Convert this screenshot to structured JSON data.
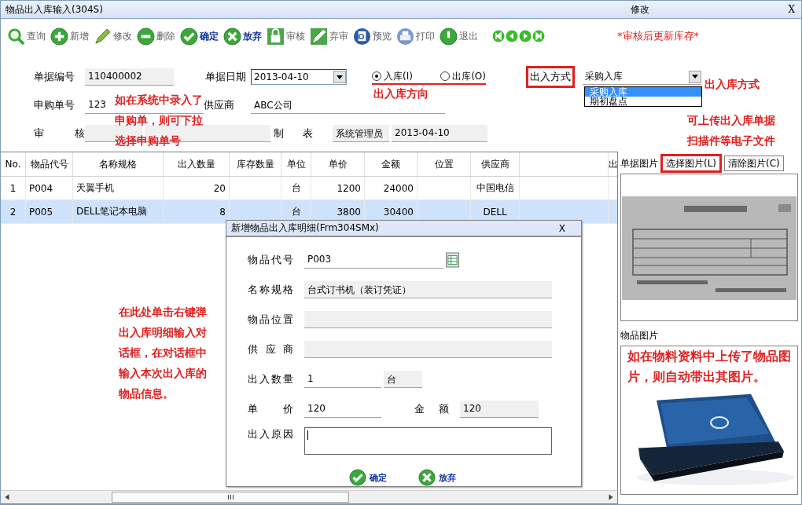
{
  "window": {
    "title": "物品出入库输入(304S)",
    "mode": "修改",
    "close": "X"
  },
  "toolbar": [
    {
      "label": "查询",
      "kind": "search",
      "disabled": true
    },
    {
      "label": "新增",
      "kind": "add",
      "disabled": true
    },
    {
      "label": "修改",
      "kind": "edit",
      "disabled": true
    },
    {
      "label": "删除",
      "kind": "delete",
      "disabled": true
    },
    {
      "label": "确定",
      "kind": "confirm",
      "disabled": false
    },
    {
      "label": "放弃",
      "kind": "cancel",
      "disabled": false
    },
    {
      "label": "审核",
      "kind": "audit",
      "disabled": true
    },
    {
      "label": "弃审",
      "kind": "unaudit",
      "disabled": true
    },
    {
      "label": "预览",
      "kind": "preview",
      "disabled": true
    },
    {
      "label": "打印",
      "kind": "print",
      "disabled": true
    },
    {
      "label": "退出",
      "kind": "exit",
      "disabled": true
    }
  ],
  "toolbar_note": "*审核后更新库存*",
  "form": {
    "doc_no": {
      "label": "单据编号",
      "value": "110400002"
    },
    "doc_date": {
      "label": "单据日期",
      "value": "2013-04-10"
    },
    "direction": [
      {
        "label": "入库(I)",
        "selected": true
      },
      {
        "label": "出库(O)",
        "selected": false
      }
    ],
    "direction_note": "出入库方向",
    "method": {
      "label": "出入方式",
      "highlighted": true,
      "value": "采购入库",
      "options": [
        {
          "label": "采购入库",
          "selected": true
        },
        {
          "label": "期初盘点",
          "selected": false
        }
      ],
      "note": "出入库方式"
    },
    "request_no": {
      "label": "申购单号",
      "value": "123",
      "note": "如在系统中录入了申购单，则可下拉选择申购单号"
    },
    "supplier": {
      "label": "供应商",
      "value": "ABC公司"
    },
    "reviewer": {
      "label": "审 核"
    },
    "maker": {
      "label": "制 表",
      "value": "系统管理员",
      "date": "2013-04-10"
    },
    "upload_note": "可上传出入库单据扫描件等电子文件"
  },
  "table": {
    "columns": [
      "No.",
      "物品代号",
      "名称规格",
      "出入数量",
      "库存数量",
      "单位",
      "单价",
      "金额",
      "位置",
      "供应商",
      "出"
    ],
    "rows": [
      {
        "no": "1",
        "code": "P004",
        "name": "天翼手机",
        "qty": "20",
        "unit": "台",
        "price": "1200",
        "amount": "24000",
        "supplier": "中国电信",
        "selected": false
      },
      {
        "no": "2",
        "code": "P005",
        "name": "DELL笔记本电脑",
        "qty": "8",
        "unit": "台",
        "price": "3800",
        "amount": "30400",
        "supplier": "DELL",
        "selected": true
      }
    ],
    "note": "在此处单击右键弹出入库明细输入对话框，在对话框中输入本次出入库的物品信息。"
  },
  "dialog": {
    "title": "新增物品出入库明细(Frm304SMx)",
    "close": "X",
    "fields": [
      {
        "label": "物品代号",
        "value": "P003",
        "kind": "lookup"
      },
      {
        "label": "名称规格",
        "value": "台式订书机（装订凭证）",
        "kind": "readonly"
      },
      {
        "label": "物品位置",
        "kind": "readonly"
      },
      {
        "label": "供应商",
        "kind": "readonly"
      },
      {
        "label": "出入数量",
        "value": "1",
        "unit": "台",
        "kind": "quantity"
      },
      {
        "label": "单 价",
        "value": "120",
        "total_label": "金 额",
        "total": "120",
        "kind": "price"
      },
      {
        "label": "出入原因",
        "kind": "memo"
      }
    ],
    "buttons": [
      {
        "label": "确定",
        "kind": "confirm"
      },
      {
        "label": "放弃",
        "kind": "cancel"
      }
    ]
  },
  "attachments": {
    "label": "单据图片",
    "buttons": [
      {
        "label": "选择图片(L)",
        "highlighted": true
      },
      {
        "label": "清除图片(C)",
        "highlighted": false
      }
    ],
    "item_label": "物品图片",
    "item_note": "如在物料资料中上传了物品图片，则自动带出其图片。"
  }
}
